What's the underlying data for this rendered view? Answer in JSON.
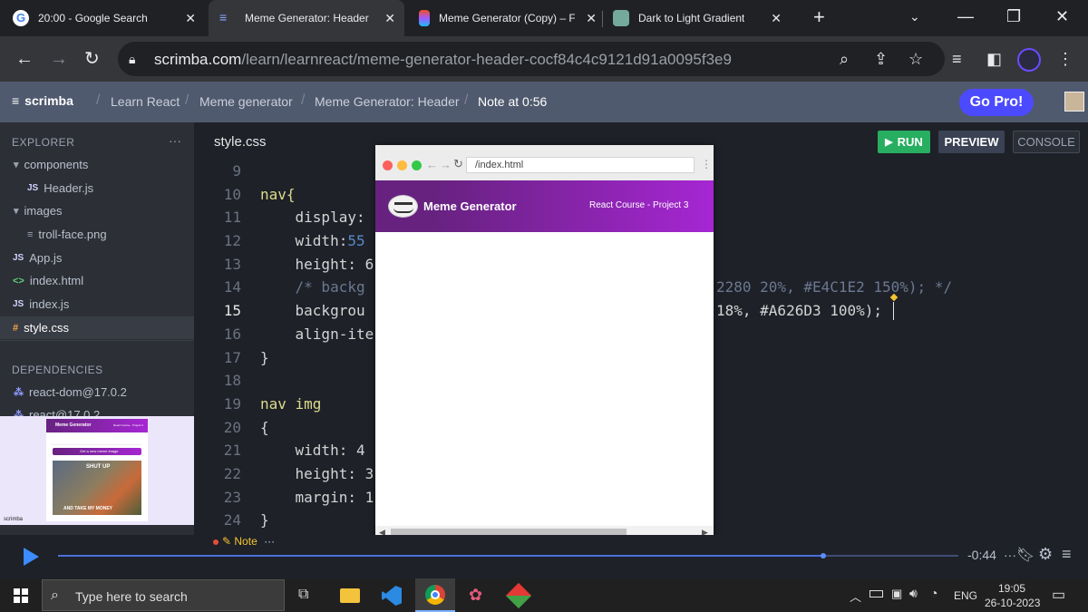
{
  "browser": {
    "tabs": [
      {
        "title": "20:00 - Google Search"
      },
      {
        "title": "Meme Generator: Header"
      },
      {
        "title": "Meme Generator (Copy) – Fi"
      },
      {
        "title": "Dark to Light Gradient"
      }
    ],
    "url_host": "scrimba.com",
    "url_path": "/learn/learnreact/meme-generator-header-cocf84c4c9121d91a0095f3e9"
  },
  "scrimba": {
    "logo": "scrimba",
    "breadcrumbs": [
      "Learn React",
      "Meme generator",
      "Meme Generator: Header",
      "Note at 0:56"
    ],
    "go_pro": "Go Pro!"
  },
  "sidebar": {
    "explorer_title": "EXPLORER",
    "more": "···",
    "items": [
      {
        "icon": "▾",
        "label": "components"
      },
      {
        "icon": "JS",
        "label": "Header.js"
      },
      {
        "icon": "▾",
        "label": "images"
      },
      {
        "icon": "≡",
        "label": "troll-face.png"
      },
      {
        "icon": "JS",
        "label": "App.js"
      },
      {
        "icon": "<>",
        "label": "index.html"
      },
      {
        "icon": "JS",
        "label": "index.js"
      },
      {
        "icon": "#",
        "label": "style.css"
      }
    ],
    "dependencies_title": "DEPENDENCIES",
    "deps": [
      "react-dom@17.0.2",
      "react@17.0.2"
    ]
  },
  "thumbnail": {
    "title": "Meme Generator",
    "sub": "React Course - Project 3",
    "button": "Get a new meme image",
    "top_text": "SHUT UP",
    "bottom_text": "AND TAKE MY MONEY",
    "brand": "scrimba"
  },
  "editor": {
    "file": "style.css",
    "run": "RUN",
    "preview": "PREVIEW",
    "console": "CONSOLE",
    "line_numbers": [
      "9",
      "10",
      "11",
      "12",
      "13",
      "14",
      "15",
      "16",
      "17",
      "18",
      "19",
      "20",
      "21",
      "22",
      "23",
      "24"
    ],
    "fragments": {
      "l10": "nav{",
      "l11": "    display:",
      "l12a": "    width:",
      "l12b": "55",
      "l13": "    height: 6",
      "l14a": "    /* backg",
      "l14b": "2280 20%, #E4C1E2 150%); */",
      "l15a": "    backgrou",
      "l15b": "18%, #A626D3 100%);",
      "l16": "    align-ite",
      "l17": "}",
      "l19a": "nav",
      "l19b": " img",
      "l20": "{",
      "l21": "    width: 4",
      "l22": "    height: 3",
      "l23": "    margin: 1",
      "l24": "}"
    }
  },
  "preview": {
    "url": "/index.html",
    "nav_title": "Meme Generator",
    "nav_subtitle": "React Course - Project 3",
    "gradient_start": "#672280",
    "gradient_end": "#A626D3"
  },
  "player": {
    "note_label": "Note",
    "note_more": "···",
    "time": "-0:44",
    "more": "···",
    "progress": 0.85
  },
  "taskbar": {
    "search_placeholder": "Type here to search",
    "lang": "ENG",
    "time": "19:05",
    "date": "26-10-2023"
  }
}
